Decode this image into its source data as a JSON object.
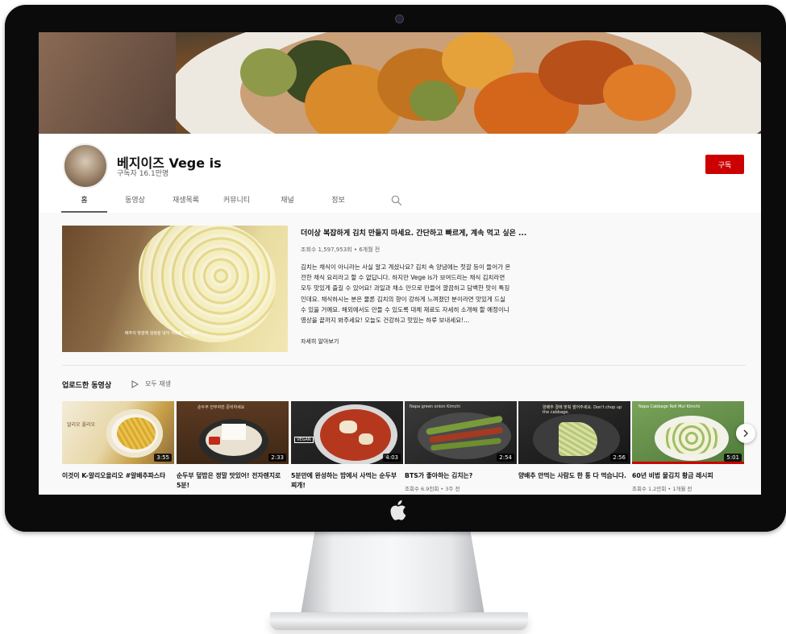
{
  "channel": {
    "name": "베지이즈 Vege is",
    "subscribers": "구독자 16.1만명",
    "subscribe_label": "구독"
  },
  "tabs": [
    "홈",
    "동영상",
    "재생목록",
    "커뮤니티",
    "채널",
    "정보"
  ],
  "featured": {
    "title": "더이상 복잡하게 김치 만들지 마세요. 간단하고 빠르게, 계속 먹고 싶은 ...",
    "meta": "조회수 1,597,953회 • 6개월 전",
    "description": "김치는 채식이 아니라는 사실 알고 계셨나요? 김치 속 양념에는 젓갈 등이 들어가 온전한 채식 요리라고 할 수 없답니다. 하지만 Vege is가 보여드리는 채식 김치라면 모두 맛있게 즐길 수 있어요! 과일과 채소 만으로 만들어 깔끔하고 담백한 맛이 특징인데요. 채식하시는 분은 물론 김치의 향이 강하게 느껴졌던 분이라면 맛있게 드실 수 있을 거예요. 해외에서도 만들 수 있도록 대체 재료도 자세히 소개해 할 예정이니 영상을 끝까지 봐주세요! 오늘도 건강하고 맛있는 하루 보내세요!...",
    "read_more": "자세히 알아보기",
    "caption": "배추의 빛깔에 검정을 넣어 사용된 배추계요"
  },
  "uploads": {
    "section_title": "업로드한 동영상",
    "play_all": "모두 재생",
    "videos": [
      {
        "title": "이것이 K-알리오올리오 #알배추파스타",
        "meta": "",
        "duration": "3:55",
        "overlay": "알리오 올리오"
      },
      {
        "title": "순두부 덮밥은 정말 맛있어! 전자렌지로 5분!",
        "meta": "",
        "duration": "2:33",
        "overlay": "순두부 전부자만 준비하세요"
      },
      {
        "title": "5분만에 완성하는 밥에서 사먹는 순두부찌개!",
        "meta": "",
        "duration": "4:03",
        "overlay": "VEGAN"
      },
      {
        "title": "BTS가 좋아하는 김치는?",
        "meta": "조회수 6.9천회 • 3주 전",
        "duration": "2:54",
        "overlay": "Napa green onion Kimchi"
      },
      {
        "title": "양배추 안먹는 사람도 한 통 다 먹습니다.",
        "meta": "",
        "duration": "2:56",
        "overlay": "양배추 결에 맞춰 썰어주세요. Don't chop up the cabbage."
      },
      {
        "title": "60년 비법 물김치 황금 레시피",
        "meta": "조회수 1.2만회 • 1개월 전",
        "duration": "5:01",
        "overlay": "Napa Cabbage Roll Mul Kimchi"
      }
    ]
  },
  "colors": {
    "subscribe": "#cc0000",
    "bezel": "#0b0b0c",
    "screen_bg": "#f9f9f9"
  }
}
